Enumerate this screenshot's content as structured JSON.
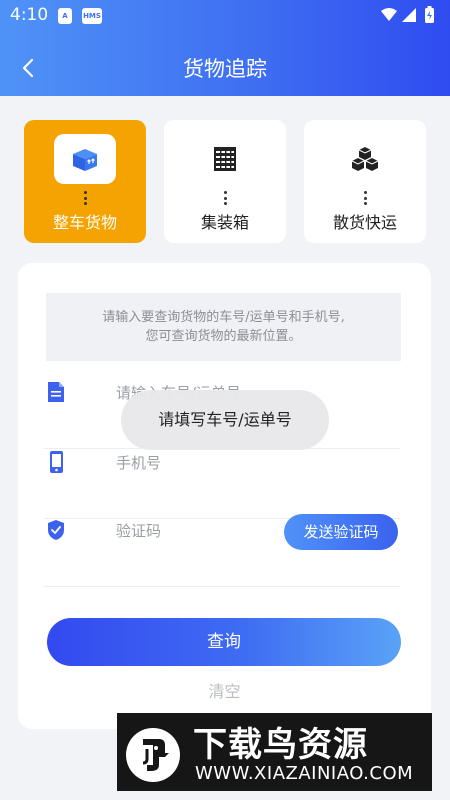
{
  "status_bar": {
    "time": "4:10",
    "app_badge_1": "A",
    "app_badge_2": "HMS"
  },
  "navbar": {
    "title": "货物追踪",
    "back_icon": "chevron-left-icon"
  },
  "categories": [
    {
      "label": "整车货物",
      "icon": "truck-box-icon",
      "active": true
    },
    {
      "label": "集装箱",
      "icon": "container-icon",
      "active": false
    },
    {
      "label": "散货快运",
      "icon": "boxes-icon",
      "active": false
    }
  ],
  "form": {
    "hint_line1": "请输入要查询货物的车号/运单号和手机号,",
    "hint_line2": "您可查询货物的最新位置。",
    "waybill_placeholder": "请输入车号/运单号",
    "phone_placeholder": "手机号",
    "code_placeholder": "验证码",
    "send_code_label": "发送验证码",
    "query_label": "查询",
    "clear_label": "清空"
  },
  "toast": {
    "message": "请填写车号/运单号"
  },
  "watermark": {
    "title": "下载鸟资源",
    "url": "WWW.XIAZAINIAO.COM"
  },
  "colors": {
    "accent": "#3f6ff2",
    "active_category": "#f5a300"
  }
}
